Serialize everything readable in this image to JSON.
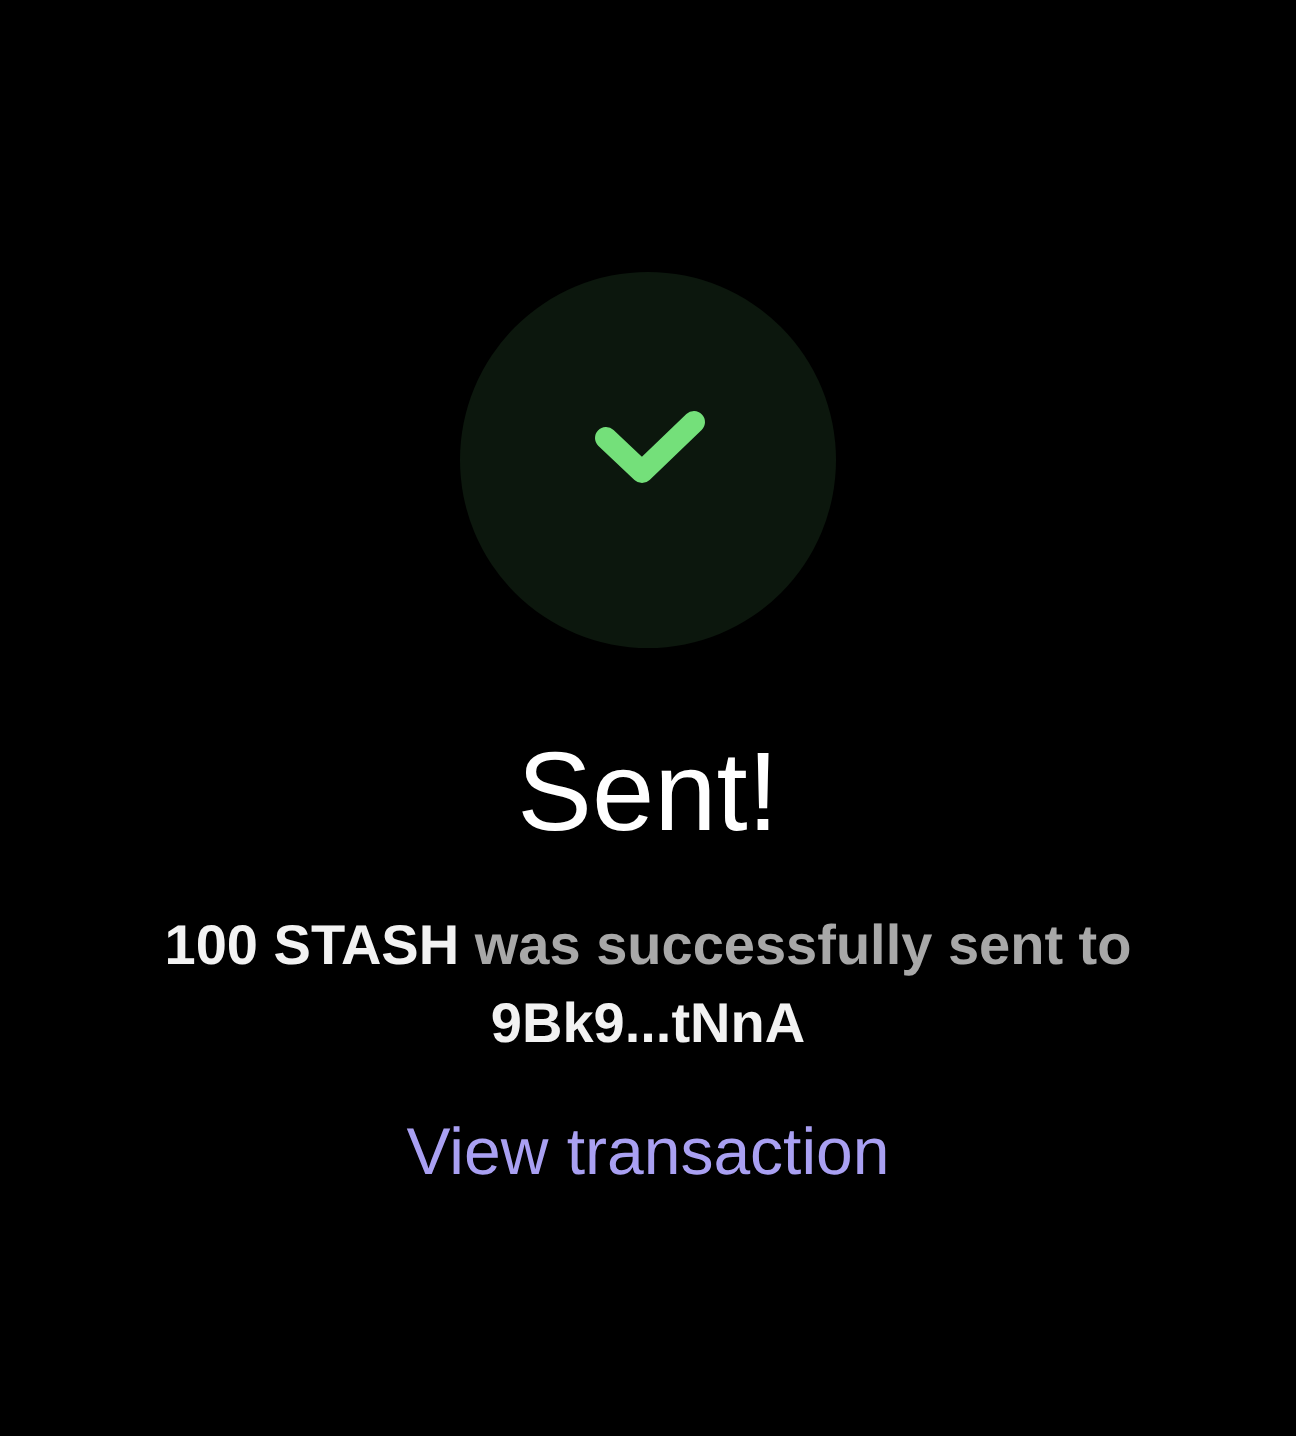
{
  "status": {
    "title": "Sent!",
    "message": "**100 STASH** was successfully sent to **9Bk9...tNnA**"
  },
  "link": {
    "label": "View transaction"
  }
}
